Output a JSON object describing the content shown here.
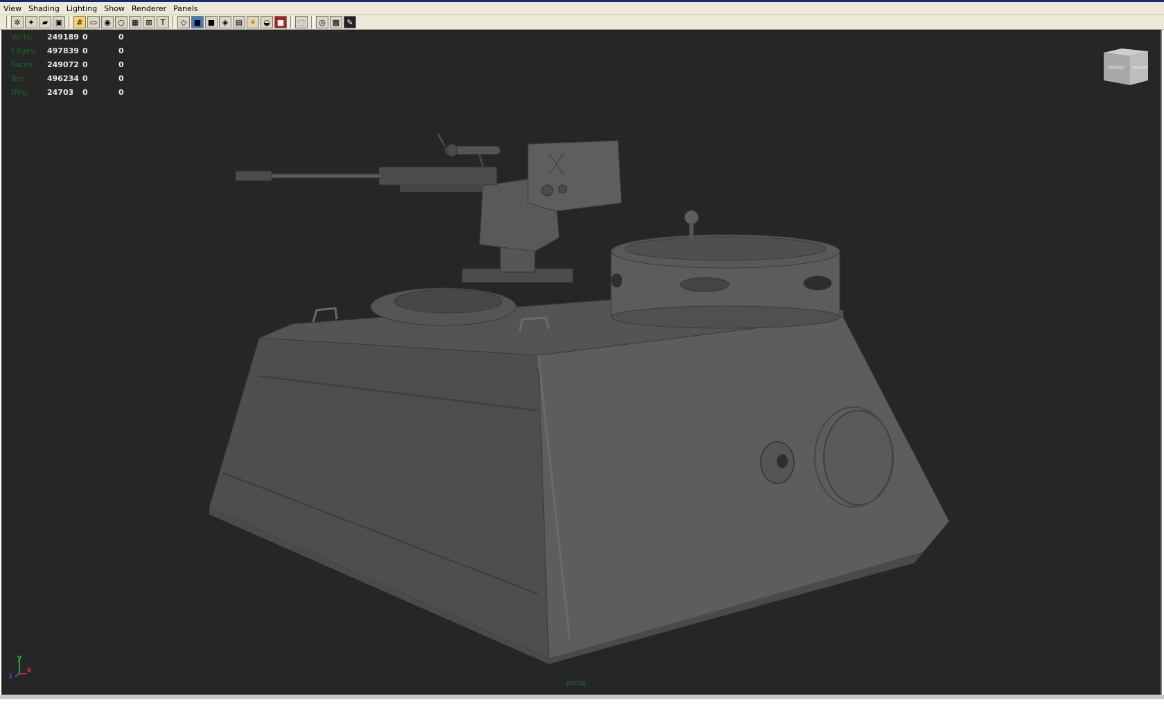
{
  "menu": [
    "View",
    "Shading",
    "Lighting",
    "Show",
    "Renderer",
    "Panels"
  ],
  "toolbar_icons": [
    "select-camera-icon",
    "camera-attributes-icon",
    "bookmark-icon",
    "image-plane-icon",
    "grid-icon",
    "film-gate-icon",
    "resolution-gate-icon",
    "gate-mask-icon",
    "field-chart-icon",
    "safe-action-icon",
    "safe-title-icon",
    "wireframe-icon",
    "smooth-shade-icon",
    "flat-shade-icon",
    "bounding-box-icon",
    "textured-icon",
    "use-all-lights-icon",
    "shadows-icon",
    "xray-icon",
    "frame-all-icon",
    "isolate-select-icon",
    "hud-toggle-icon",
    "snapshot-icon"
  ],
  "hud": {
    "rows": [
      {
        "label": "Verts:",
        "v1": "249189",
        "v2": "0",
        "v3": "0"
      },
      {
        "label": "Edges:",
        "v1": "497839",
        "v2": "0",
        "v3": "0"
      },
      {
        "label": "Faces:",
        "v1": "249072",
        "v2": "0",
        "v3": "0"
      },
      {
        "label": "Tris:",
        "v1": "496234",
        "v2": "0",
        "v3": "0"
      },
      {
        "label": "UVs:",
        "v1": "24703",
        "v2": "0",
        "v3": "0"
      }
    ]
  },
  "viewcube": {
    "front": "FRONT",
    "right": "RIGHT"
  },
  "axis": {
    "y": "y",
    "x": "x",
    "z": "z",
    "y_color": "#27c93a",
    "x_color": "#e43b3b",
    "z_color": "#3b6cff"
  },
  "camera_name": "persp",
  "colors": {
    "viewport_bg": "#262626",
    "model_gray": "#5a5a5a",
    "hud_label": "#136b23"
  }
}
